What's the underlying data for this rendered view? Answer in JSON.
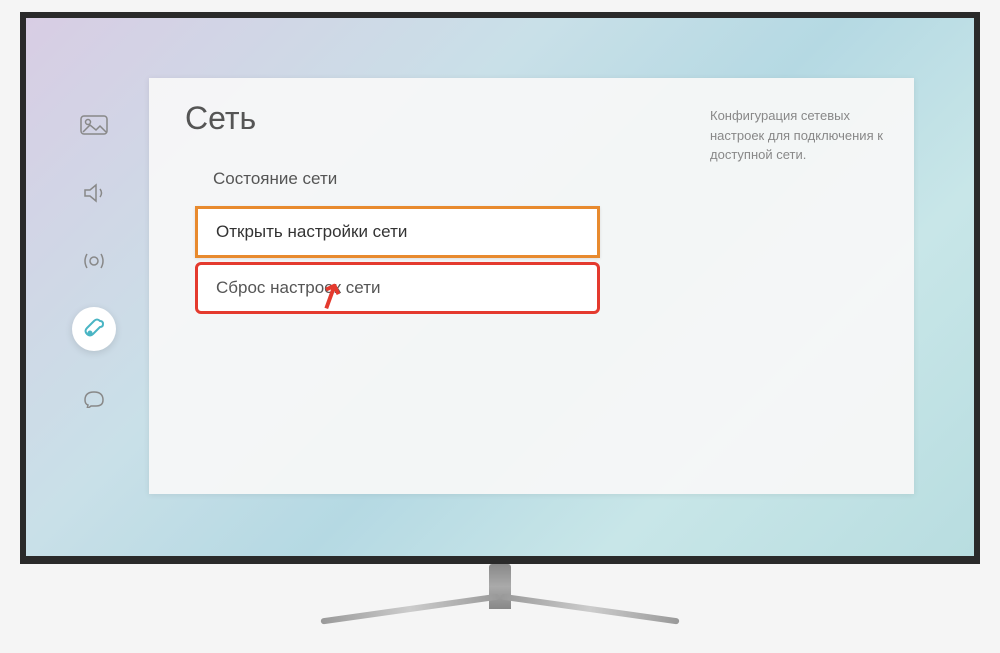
{
  "panel": {
    "title": "Сеть",
    "help": "Конфигурация сетевых настроек для подключения к доступной сети."
  },
  "menu": {
    "status": "Состояние сети",
    "open_settings": "Открыть настройки сети",
    "reset": "Сброс настроек сети"
  },
  "sidebar": {
    "picture": "picture",
    "sound": "sound",
    "broadcast": "broadcast",
    "general": "general",
    "support": "support"
  }
}
